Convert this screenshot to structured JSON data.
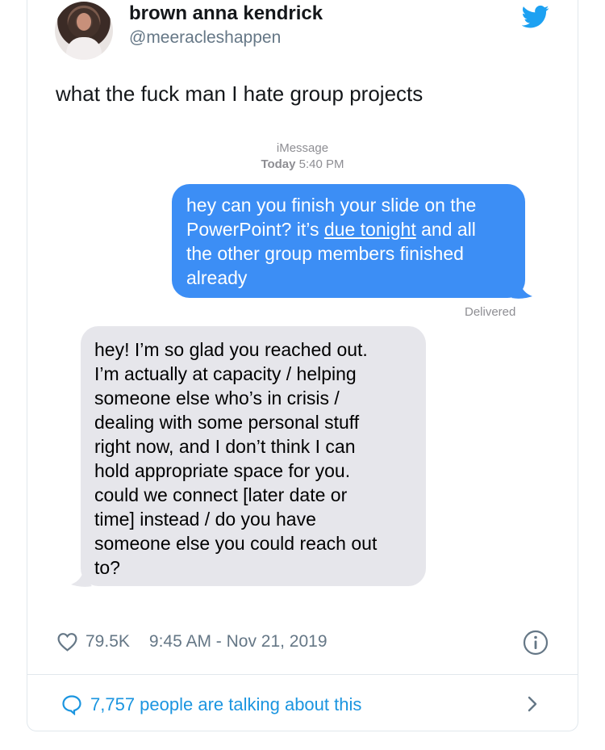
{
  "tweet": {
    "display_name": "brown anna kendrick",
    "handle": "@meeracleshappen",
    "text": "what the fuck man I hate group projects"
  },
  "imessage": {
    "service_label": "iMessage",
    "day_label": "Today",
    "time_label": "5:40 PM",
    "outgoing": {
      "line1": "hey can you finish your slide on the",
      "line2_before": "PowerPoint? it’s ",
      "line2_link": "due tonight",
      "line2_after": " and all",
      "line3": "the other group members finished",
      "line4": "already"
    },
    "status": "Delivered",
    "incoming": {
      "lines": [
        "hey! I’m so glad you reached out.",
        "I’m actually at capacity / helping",
        "someone else who’s in crisis /",
        "dealing with some personal stuff",
        "right now, and I don’t think I can",
        "hold appropriate space for you.",
        "could we connect [later date or",
        "time] instead / do you have",
        "someone else you could reach out",
        "to?"
      ]
    },
    "colors": {
      "outgoing_bubble": "#3c8ef5",
      "incoming_bubble": "#e6e6eb"
    }
  },
  "meta": {
    "likes": "79.5K",
    "timestamp": "9:45 AM - Nov 21, 2019"
  },
  "footer": {
    "talking_label": "7,757 people are talking about this"
  },
  "icons": [
    "twitter-bird-icon",
    "heart-icon",
    "info-icon",
    "speech-bubble-icon",
    "chevron-right-icon"
  ],
  "accent_color": "#1da1f2"
}
